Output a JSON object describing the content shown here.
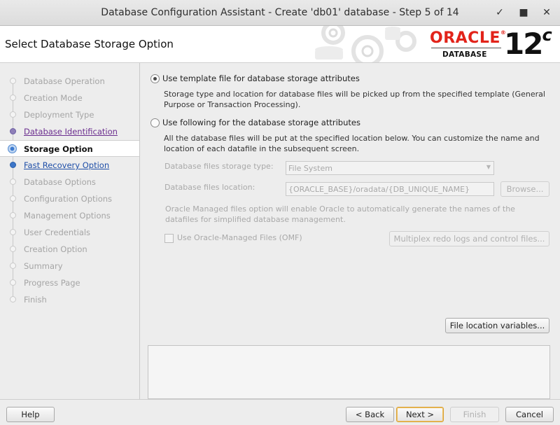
{
  "window": {
    "title": "Database Configuration Assistant - Create 'db01' database - Step 5 of 14",
    "minimize_glyph": "✓",
    "maximize_glyph": "■",
    "close_glyph": "✕"
  },
  "header": {
    "page_title": "Select Database Storage Option",
    "brand_name": "ORACLE",
    "brand_registered": "®",
    "brand_product": "DATABASE",
    "version_number": "12",
    "version_suffix": "c"
  },
  "nav": {
    "items": [
      {
        "label": "Database Operation",
        "state": "pending"
      },
      {
        "label": "Creation Mode",
        "state": "pending"
      },
      {
        "label": "Deployment Type",
        "state": "pending"
      },
      {
        "label": "Database Identification",
        "state": "visited"
      },
      {
        "label": "Storage Option",
        "state": "current"
      },
      {
        "label": "Fast Recovery Option",
        "state": "link"
      },
      {
        "label": "Database Options",
        "state": "pending"
      },
      {
        "label": "Configuration Options",
        "state": "pending"
      },
      {
        "label": "Management Options",
        "state": "pending"
      },
      {
        "label": "User Credentials",
        "state": "pending"
      },
      {
        "label": "Creation Option",
        "state": "pending"
      },
      {
        "label": "Summary",
        "state": "pending"
      },
      {
        "label": "Progress Page",
        "state": "pending"
      },
      {
        "label": "Finish",
        "state": "pending"
      }
    ]
  },
  "content": {
    "option_template": {
      "label": "Use template file for database storage attributes",
      "selected": true,
      "description": "Storage type and location for database files will be picked up from the specified template (General Purpose or Transaction Processing)."
    },
    "option_following": {
      "label": "Use following for the database storage attributes",
      "selected": false,
      "description": "All the database files will be put at the specified location below. You can customize the name and location of each datafile in the subsequent screen."
    },
    "storage_type": {
      "label": "Database files storage type:",
      "value": "File System"
    },
    "files_location": {
      "label": "Database files location:",
      "value": "{ORACLE_BASE}/oradata/{DB_UNIQUE_NAME}",
      "browse_label": "Browse..."
    },
    "omf_description": "Oracle Managed files option will enable Oracle to automatically generate the names of the datafiles for simplified database management.",
    "omf_checkbox_label": "Use Oracle-Managed Files (OMF)",
    "multiplex_button": "Multiplex redo logs and control files...",
    "file_location_variables_button": "File location variables..."
  },
  "footer": {
    "help": "Help",
    "back": "< Back",
    "next": "Next >",
    "finish": "Finish",
    "cancel": "Cancel"
  },
  "colors": {
    "brand_red": "#e2231a",
    "link_blue": "#1f4fa8",
    "visited_purple": "#6b2e8f"
  }
}
